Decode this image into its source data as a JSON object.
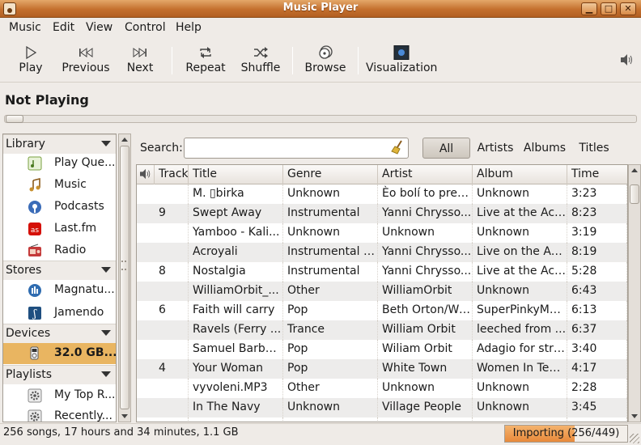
{
  "window": {
    "title": "Music Player",
    "minimize": "▁",
    "maximize": "□",
    "close": "✕"
  },
  "menu": [
    {
      "label": "Music"
    },
    {
      "label": "Edit"
    },
    {
      "label": "View"
    },
    {
      "label": "Control"
    },
    {
      "label": "Help"
    }
  ],
  "toolbar": {
    "play": "Play",
    "previous": "Previous",
    "next": "Next",
    "repeat": "Repeat",
    "shuffle": "Shuffle",
    "browse": "Browse",
    "visualization": "Visualization"
  },
  "now_playing": "Not Playing",
  "seek_position": 0,
  "sidebar": {
    "library": {
      "label": "Library",
      "items": [
        "Play Que...",
        "Music",
        "Podcasts",
        "Last.fm",
        "Radio"
      ]
    },
    "stores": {
      "label": "Stores",
      "items": [
        "Magnatu...",
        "Jamendo"
      ]
    },
    "devices": {
      "label": "Devices",
      "items": [
        "32.0 GB..."
      ]
    },
    "playlists": {
      "label": "Playlists",
      "items": [
        "My Top R...",
        "Recently..."
      ]
    }
  },
  "search": {
    "label": "Search:",
    "value": "",
    "placeholder": ""
  },
  "filters": {
    "all": "All",
    "artists": "Artists",
    "albums": "Albums",
    "titles": "Titles"
  },
  "columns": {
    "track": "Track",
    "title": "Title",
    "genre": "Genre",
    "artist": "Artist",
    "album": "Album",
    "time": "Time"
  },
  "rows": [
    {
      "track": "",
      "title": "M. ▯birka",
      "genre": "Unknown",
      "artist": "Èo bolí to preb...",
      "album": "Unknown",
      "time": "3:23"
    },
    {
      "track": "9",
      "title": "Swept Away",
      "genre": "Instrumental",
      "artist": "Yanni Chrysso...",
      "album": "Live at the Acr...",
      "time": "8:23"
    },
    {
      "track": "",
      "title": "Yamboo - Kali...",
      "genre": "Unknown",
      "artist": "Unknown",
      "album": "Unknown",
      "time": "3:19"
    },
    {
      "track": "",
      "title": "Acroyali",
      "genre": "Instrumental P...",
      "artist": "Yanni Chrysso...",
      "album": "Live on the Acr...",
      "time": "8:19"
    },
    {
      "track": "8",
      "title": "Nostalgia",
      "genre": "Instrumental",
      "artist": "Yanni Chrysso...",
      "album": "Live at the Acr...",
      "time": "5:28"
    },
    {
      "track": "",
      "title": "WilliamOrbit_...",
      "genre": "Other",
      "artist": "WilliamOrbit",
      "album": "Unknown",
      "time": "6:43"
    },
    {
      "track": "6",
      "title": "Faith will carry",
      "genre": "Pop",
      "artist": "Beth Orton/Wil...",
      "album": "SuperPinkyMa...",
      "time": "6:13"
    },
    {
      "track": "",
      "title": "Ravels (Ferry ...",
      "genre": "Trance",
      "artist": "William Orbit",
      "album": "leeched from ...",
      "time": "6:37"
    },
    {
      "track": "",
      "title": "Samuel Barber...",
      "genre": "Pop",
      "artist": "Wiliam Orbit",
      "album": "Adagio for stri...",
      "time": "3:40"
    },
    {
      "track": "4",
      "title": "Your Woman",
      "genre": "Pop",
      "artist": "White Town",
      "album": "Women In Tech...",
      "time": "4:17"
    },
    {
      "track": "",
      "title": "vyvoleni.MP3",
      "genre": "Other",
      "artist": "Unknown",
      "album": "Unknown",
      "time": "2:28"
    },
    {
      "track": "",
      "title": "In The Navy",
      "genre": "Unknown",
      "artist": "Village People",
      "album": "Unknown",
      "time": "3:45"
    },
    {
      "track": "",
      "title": "...",
      "genre": "...",
      "artist": "...",
      "album": "...",
      "time": "..."
    }
  ],
  "status": {
    "summary": "256 songs, 17 hours and 34 minutes, 1.1 GB",
    "importing": "Importing (256/449)",
    "import_fraction": 0.57
  },
  "icons": {
    "app": "app-icon",
    "volume": "volume-icon",
    "search_clear": "broom-icon"
  }
}
